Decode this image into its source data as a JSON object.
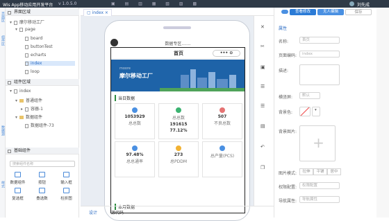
{
  "topbar": {
    "logo": "Wis App移动应用开发平台",
    "version": "v 1.0.5.0",
    "user": "刘先成"
  },
  "left_strip": [
    "页面区",
    "组件区",
    "数据源",
    "样式"
  ],
  "tree": {
    "page_section": "界面区域",
    "nodes": [
      "摩尔移动工厂",
      "page",
      "board",
      "buttonTest",
      "echarts",
      "index",
      "loop"
    ],
    "comp_section": "组件区域",
    "comp_nodes": [
      "index",
      "普通组件",
      "容器-1",
      "数据组件",
      "数据组件-73"
    ]
  },
  "basic": {
    "title": "基础组件",
    "search_placeholder": "搜索组件名称",
    "items": [
      "数据组件",
      "按钮",
      "输入框",
      "复选框",
      "叠选数",
      "柱折图"
    ]
  },
  "editor": {
    "tab": "index"
  },
  "phone": {
    "status": "数据专区.......",
    "title": "首页",
    "capsule": "••• ⊙",
    "banner_small": "moore",
    "banner_big": "摩尔移动工厂",
    "sect1": "当日数据",
    "sect2": "本月数据",
    "cards": [
      {
        "v": "1053929",
        "l": "总总数",
        "icon": "bars-icon"
      },
      {
        "v": "191615",
        "v2": "77.12%",
        "l": "总总数",
        "icon": "check-icon"
      },
      {
        "v": "507",
        "l": "不良总数",
        "icon": "pie-icon"
      },
      {
        "v": "97.48%",
        "l": "总总通率",
        "icon": "bars-icon"
      },
      {
        "v": "273",
        "l": "总PDDM",
        "icon": "sun-icon"
      },
      {
        "v": "",
        "l": "总产量(PCS)",
        "icon": "triangle-icon"
      }
    ]
  },
  "bottom": {
    "design": "设计",
    "source": "源代码"
  },
  "right": {
    "buttons": [
      "查看修改",
      "无人编辑",
      "保存"
    ],
    "heading": "属性",
    "props": [
      {
        "label": "名称:",
        "value": "首页"
      },
      {
        "label": "页面编码:",
        "value": "index"
      },
      {
        "label": "描述:",
        "value": ""
      },
      {
        "label": "横竖屏:",
        "value": "默认"
      },
      {
        "label": "背景色:",
        "value": ""
      },
      {
        "label": "背景图片:",
        "value": ""
      },
      {
        "label": "图片模式:",
        "value": ""
      },
      {
        "label": "权限配置:",
        "value": "权限配置"
      },
      {
        "label": "导航属性:",
        "value": "导航属性"
      }
    ],
    "img_modes": [
      "拉伸",
      "平铺",
      "居中"
    ]
  }
}
